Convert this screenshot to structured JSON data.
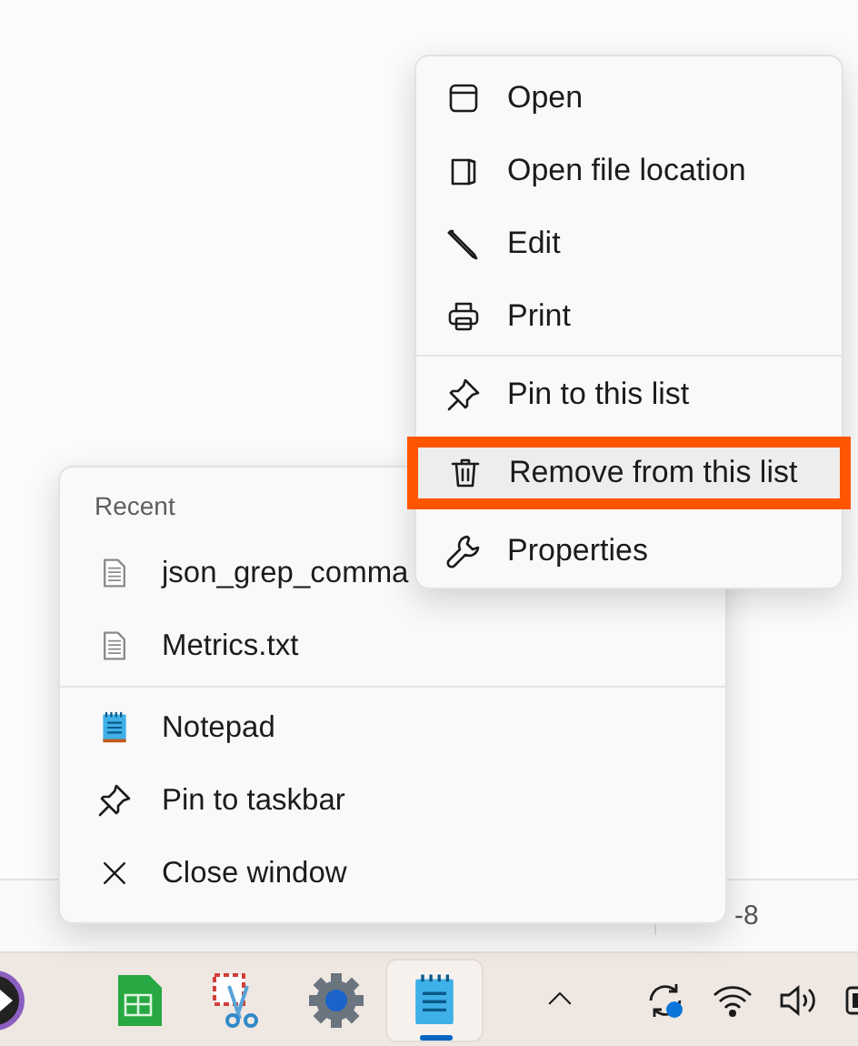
{
  "status_bar": {
    "encoding": "-8"
  },
  "jump_list": {
    "header": "Recent",
    "recent": [
      {
        "label": "json_grep_comma"
      },
      {
        "label": "Metrics.txt"
      }
    ],
    "tasks": [
      {
        "label": "Notepad"
      },
      {
        "label": "Pin to taskbar"
      },
      {
        "label": "Close window"
      }
    ]
  },
  "context_menu": {
    "groups": [
      [
        {
          "label": "Open",
          "selected": false
        },
        {
          "label": "Open file location",
          "selected": false
        },
        {
          "label": "Edit",
          "selected": false
        },
        {
          "label": "Print",
          "selected": false
        }
      ],
      [
        {
          "label": "Pin to this list",
          "selected": false
        },
        {
          "label": "Remove from this list",
          "selected": true
        },
        {
          "label": "Properties",
          "selected": false
        }
      ]
    ]
  },
  "taskbar": {
    "apps": [
      {
        "selected": false
      },
      {
        "selected": false
      },
      {
        "selected": false
      },
      {
        "selected": false
      },
      {
        "selected": true
      }
    ]
  }
}
